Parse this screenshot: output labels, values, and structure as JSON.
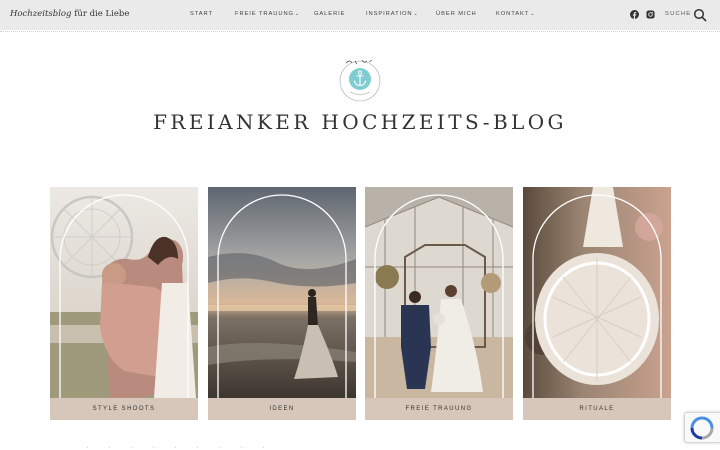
{
  "header": {
    "site_title_italic": "Hochzeitsblog",
    "site_title_rest": " für die Liebe",
    "nav": [
      {
        "label": "START",
        "dropdown": false
      },
      {
        "label": "FREIE TRAUUNG",
        "dropdown": true
      },
      {
        "label": "GALERIE",
        "dropdown": false
      },
      {
        "label": "INSPIRATION",
        "dropdown": true
      },
      {
        "label": "ÜBER MICH",
        "dropdown": false
      },
      {
        "label": "KONTAKT",
        "dropdown": true
      }
    ],
    "chevron": "⌄",
    "search_label": "SUCHE",
    "social_icons": [
      "facebook-icon",
      "instagram-icon"
    ]
  },
  "hero": {
    "logo_icon": "anchor-logo-icon",
    "title": "FREIANKER HOCHZEITS-BLOG"
  },
  "cards": [
    {
      "label": "STYLE SHOOTS",
      "image": "couple-ferris-wheel"
    },
    {
      "label": "IDEEN",
      "image": "bride-beach-sunset"
    },
    {
      "label": "FREIE TRAUUNG",
      "image": "couple-greenhouse"
    },
    {
      "label": "RITUALE",
      "image": "macrame-dreamcatcher"
    }
  ],
  "colors": {
    "topbar": "#eaeaea",
    "card_label_bg": "#d6c7ba",
    "logo_accent": "#7fcdd0"
  }
}
